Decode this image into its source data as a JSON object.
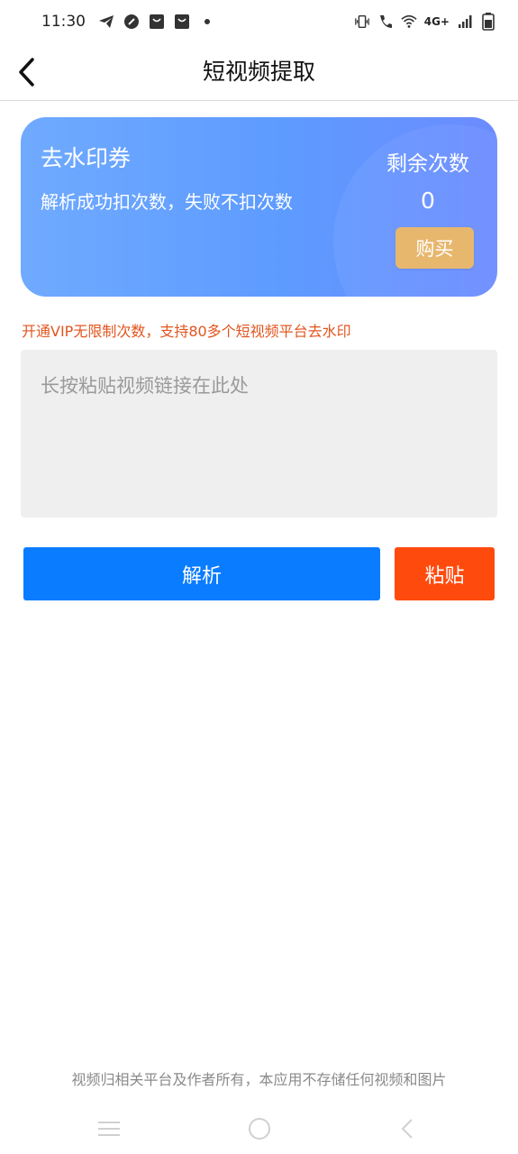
{
  "status_bar": {
    "time": "11:30",
    "network": "4G+",
    "left_icons": [
      "telegram-icon",
      "browser-icon",
      "shopping-bag-icon",
      "shopping-bag-icon",
      "dot-icon"
    ],
    "right_icons": [
      "vibrate-icon",
      "wifi-calling-icon",
      "wifi-icon",
      "signal-icon",
      "battery-icon"
    ]
  },
  "header": {
    "title": "短视频提取",
    "back_icon": "chevron-left-icon"
  },
  "coupon": {
    "title": "去水印券",
    "description": "解析成功扣次数，失败不扣次数",
    "remaining_label": "剩余次数",
    "remaining_count": "0",
    "buy_label": "购买",
    "colors": {
      "gradient_start": "#70aaff",
      "gradient_end": "#6b8bff",
      "buy_button": "#e8b76e"
    }
  },
  "vip_notice": "开通VIP无限制次数，支持80多个短视频平台去水印",
  "link_input": {
    "placeholder": "长按粘贴视频链接在此处",
    "value": ""
  },
  "actions": {
    "parse_label": "解析",
    "paste_label": "粘贴",
    "parse_color": "#0a7cff",
    "paste_color": "#ff4a0e"
  },
  "disclaimer": "视频归相关平台及作者所有，本应用不存储任何视频和图片",
  "nav_bar": {
    "icons": [
      "menu-icon",
      "home-icon",
      "back-icon"
    ]
  }
}
